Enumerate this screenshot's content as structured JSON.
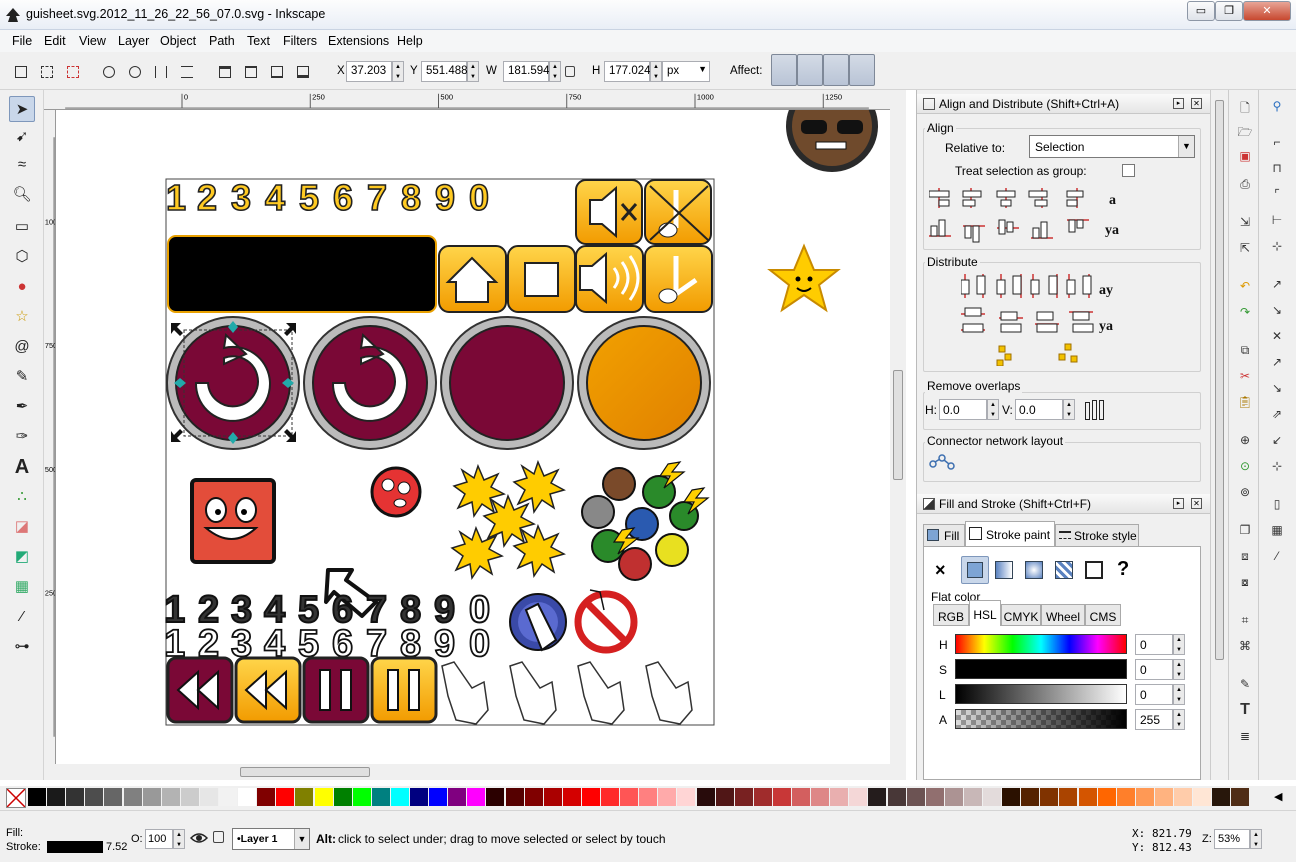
{
  "window": {
    "title": "guisheet.svg.2012_11_26_22_56_07.0.svg - Inkscape",
    "controls": {
      "minimize": "▭",
      "maximize": "❐",
      "close": "✕"
    }
  },
  "menu": [
    "File",
    "Edit",
    "View",
    "Layer",
    "Object",
    "Path",
    "Text",
    "Filters",
    "Extensions",
    "Help"
  ],
  "toolbar": {
    "x_label": "X",
    "x_value": "37.203",
    "y_label": "Y",
    "y_value": "551.488",
    "w_label": "W",
    "w_value": "181.594",
    "h_label": "H",
    "h_value": "177.024",
    "unit": "px",
    "affect_label": "Affect:"
  },
  "ruler": {
    "marks": [
      "0",
      "250",
      "500",
      "750",
      "1000",
      "1250"
    ],
    "left_marks": [
      "1000",
      "750",
      "500",
      "250"
    ]
  },
  "canvas": {
    "digits": [
      "1",
      "2",
      "3",
      "4",
      "5",
      "6",
      "7",
      "8",
      "9",
      "0"
    ]
  },
  "align_panel": {
    "title": "Align and Distribute (Shift+Ctrl+A)",
    "align_label": "Align",
    "relative_label": "Relative to:",
    "relative_value": "Selection",
    "group_label": "Treat selection as group:",
    "distribute_label": "Distribute",
    "overlaps_label": "Remove overlaps",
    "h_label": "H:",
    "h_value": "0.0",
    "v_label": "V:",
    "v_value": "0.0",
    "connector_label": "Connector network layout"
  },
  "fill_panel": {
    "title": "Fill and Stroke (Shift+Ctrl+F)",
    "tabs": [
      "Fill",
      "Stroke paint",
      "Stroke style"
    ],
    "flat_color_label": "Flat color",
    "model_tabs": [
      "RGB",
      "HSL",
      "CMYK",
      "Wheel",
      "CMS"
    ],
    "channels": [
      {
        "label": "H",
        "value": "0"
      },
      {
        "label": "S",
        "value": "0"
      },
      {
        "label": "L",
        "value": "0"
      },
      {
        "label": "A",
        "value": "255"
      }
    ],
    "unknown_mark": "?"
  },
  "palette": [
    "#000000",
    "#1a1a1a",
    "#333333",
    "#4d4d4d",
    "#666666",
    "#808080",
    "#999999",
    "#b3b3b3",
    "#cccccc",
    "#e6e6e6",
    "#f2f2f2",
    "#ffffff",
    "#800000",
    "#ff0000",
    "#808000",
    "#ffff00",
    "#008000",
    "#00ff00",
    "#008080",
    "#00ffff",
    "#000080",
    "#0000ff",
    "#800080",
    "#ff00ff",
    "#2b0000",
    "#550000",
    "#800000",
    "#aa0000",
    "#d40000",
    "#ff0000",
    "#ff2a2a",
    "#ff5555",
    "#ff8080",
    "#ffaaaa",
    "#ffd5d5",
    "#280b0b",
    "#501616",
    "#782121",
    "#a02c2c",
    "#c83737",
    "#d35f5f",
    "#de8787",
    "#e9afaf",
    "#f4d7d7",
    "#241c1c",
    "#483737",
    "#6c5353",
    "#916f6f",
    "#ac9393",
    "#c8b7b7",
    "#e3dbdb",
    "#2b1100",
    "#552200",
    "#803300",
    "#aa4400",
    "#d45500",
    "#ff6600",
    "#ff7f2a",
    "#ff9955",
    "#ffb380",
    "#ffccaa",
    "#ffe6d5",
    "#28170b",
    "#502d16"
  ],
  "status": {
    "fill_label": "Fill:",
    "stroke_label": "Stroke:",
    "stroke_width": "7.52",
    "opacity_label": "O:",
    "opacity_value": "100",
    "layer_value": "•Layer 1",
    "message_bold": "Alt:",
    "message": "click to select under; drag to move selected or select by touch",
    "x_label": "X:",
    "x_value": "821.79",
    "y_label": "Y:",
    "y_value": "812.43",
    "zoom_label": "Z:",
    "zoom_value": "53%"
  }
}
